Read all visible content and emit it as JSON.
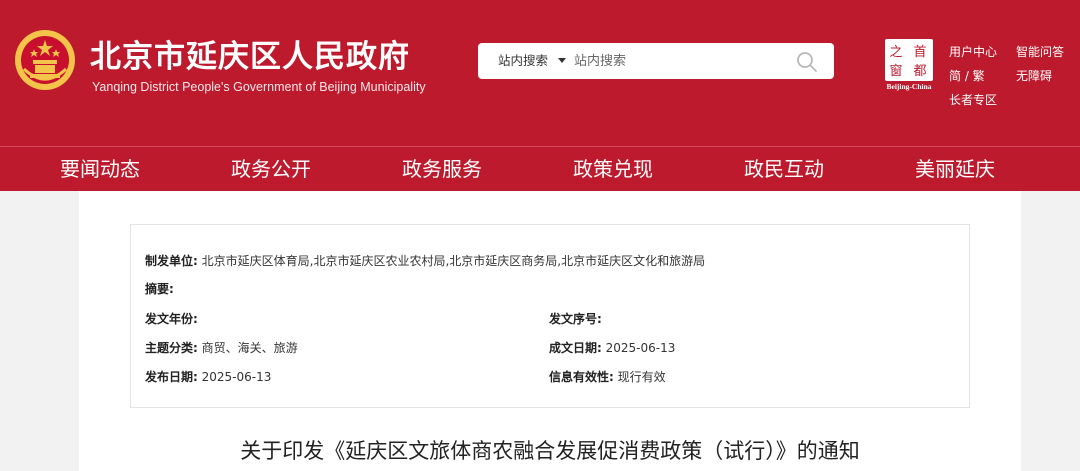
{
  "header": {
    "title": "北京市延庆区人民政府",
    "subtitle": "Yanqing District People's Government of Beijing Municipality",
    "search": {
      "scope": "站内搜索",
      "placeholder": "站内搜索"
    },
    "capital_logo": {
      "chars": [
        "之",
        "首",
        "窗",
        "都"
      ],
      "caption": "Beijing-China"
    },
    "links": {
      "user_center": "用户中心",
      "smart_qa": "智能问答",
      "simp_trad": "简 / 繁",
      "accessibility": "无障碍",
      "elderly": "长者专区"
    }
  },
  "nav": {
    "items": [
      "要闻动态",
      "政务公开",
      "政务服务",
      "政策兑现",
      "政民互动",
      "美丽延庆"
    ]
  },
  "meta": {
    "issuer": {
      "label": "制发单位:",
      "value": "北京市延庆区体育局,北京市延庆区农业农村局,北京市延庆区商务局,北京市延庆区文化和旅游局"
    },
    "abstract": {
      "label": "摘要:",
      "value": ""
    },
    "year": {
      "label": "发文年份:",
      "value": ""
    },
    "doc_no": {
      "label": "发文序号:",
      "value": ""
    },
    "topic": {
      "label": "主题分类:",
      "value": "商贸、海关、旅游"
    },
    "created": {
      "label": "成文日期:",
      "value": "2025-06-13"
    },
    "published": {
      "label": "发布日期:",
      "value": "2025-06-13"
    },
    "validity": {
      "label": "信息有效性:",
      "value": "现行有效"
    }
  },
  "article": {
    "title": "关于印发《延庆区文旅体商农融合发展促消费政策（试行）》的通知"
  },
  "colors": {
    "brand_red": "#bd1a2d",
    "emblem_gold": "#f3c34a"
  }
}
